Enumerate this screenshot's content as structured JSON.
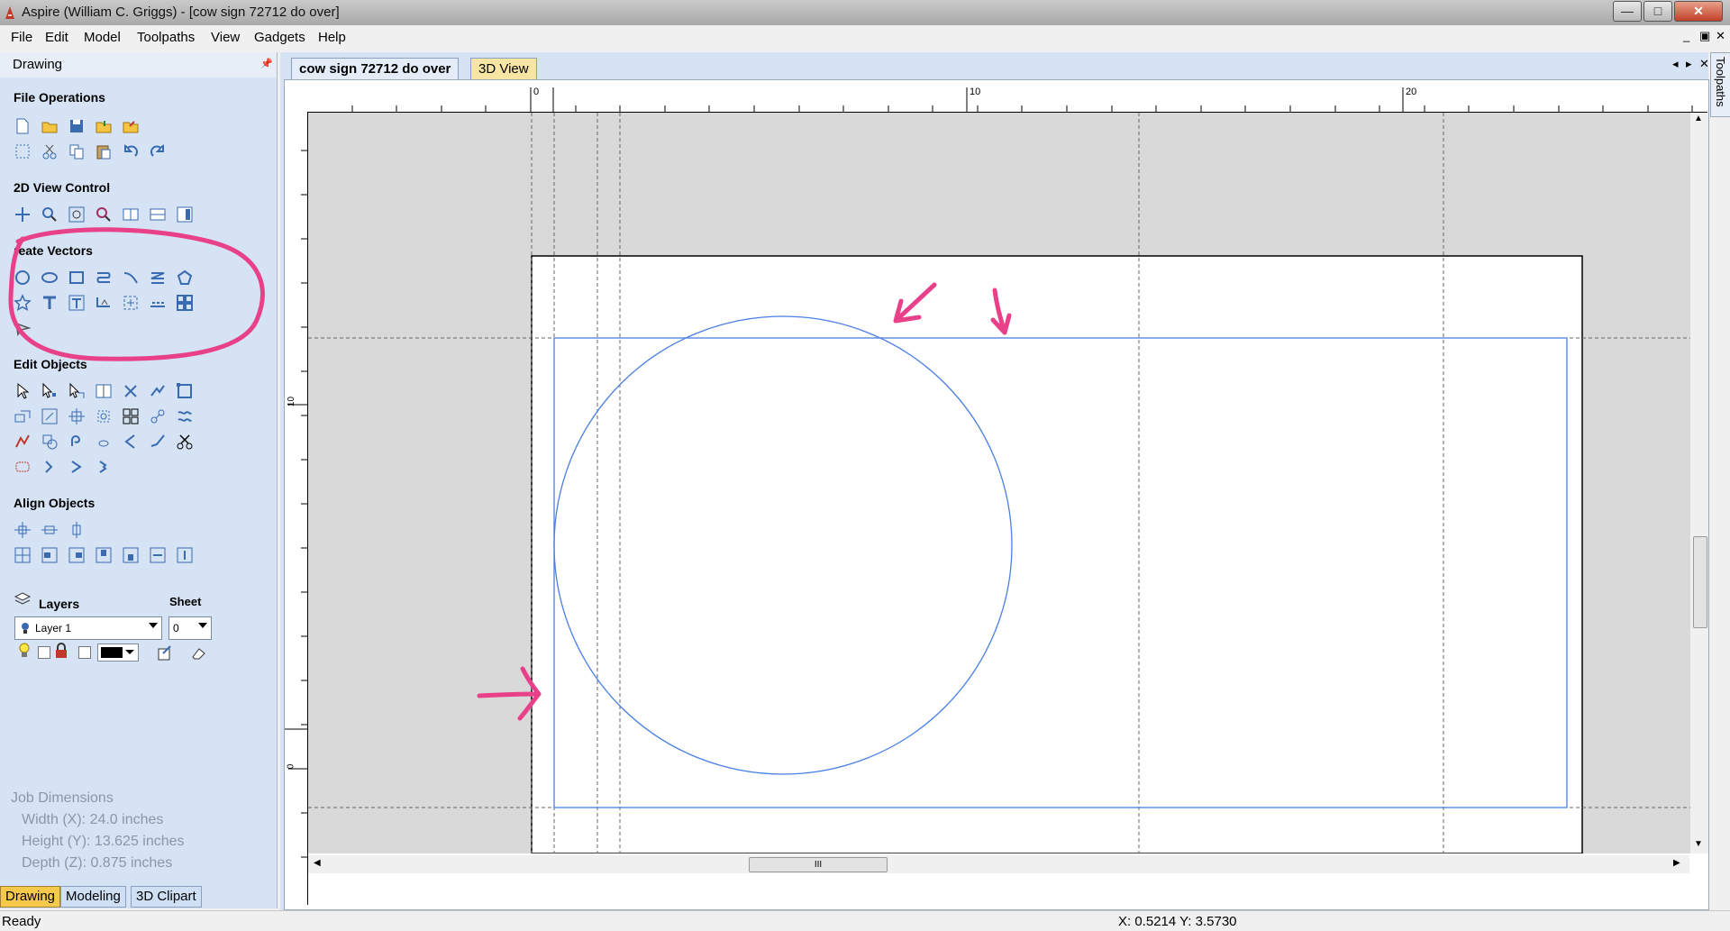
{
  "window": {
    "title": "Aspire (William C. Griggs) - [cow sign 72712 do over]",
    "minimize": "—",
    "maximize": "□",
    "close": "✕"
  },
  "menu": [
    "File",
    "Edit",
    "Model",
    "Toolpaths",
    "View",
    "Gadgets",
    "Help"
  ],
  "mdi_controls": {
    "minimize": "_",
    "restore": "▣",
    "close": "✕"
  },
  "left_panel": {
    "header": "Drawing",
    "pin": "📌",
    "sections": {
      "file_operations": "File Operations",
      "view_control": "2D View Control",
      "create_vectors": "reate Vectors",
      "edit_objects": "Edit Objects",
      "align_objects": "Align Objects"
    },
    "layers": {
      "label": "Layers",
      "sheet_label": "Sheet",
      "current_layer": "Layer 1",
      "current_sheet": "0"
    },
    "job_dimensions": {
      "title": "Job Dimensions",
      "width": "Width  (X): 24.0 inches",
      "height": "Height (Y): 13.625 inches",
      "depth": "Depth  (Z): 0.875 inches"
    },
    "bottom_tabs": [
      "Drawing",
      "Modeling",
      "3D Clipart"
    ]
  },
  "doc_tabs": [
    "cow sign 72712 do over",
    "3D View"
  ],
  "doc_nav": {
    "prev": "◂",
    "next": "▸",
    "close": "✕"
  },
  "ruler": {
    "top_labels": [
      "0",
      "10",
      "20"
    ],
    "left_labels": [
      "10",
      "0"
    ]
  },
  "right_tab": "Toolpaths",
  "scroll_grip": "III",
  "status": {
    "left": "Ready",
    "coords": "X:  0.5214 Y:  3.5730"
  },
  "colors": {
    "panel_bg": "#d6e3f4",
    "vector_blue": "#4a7fe6",
    "annotation_pink": "#e8418a",
    "active_tab": "#f7c94b"
  }
}
